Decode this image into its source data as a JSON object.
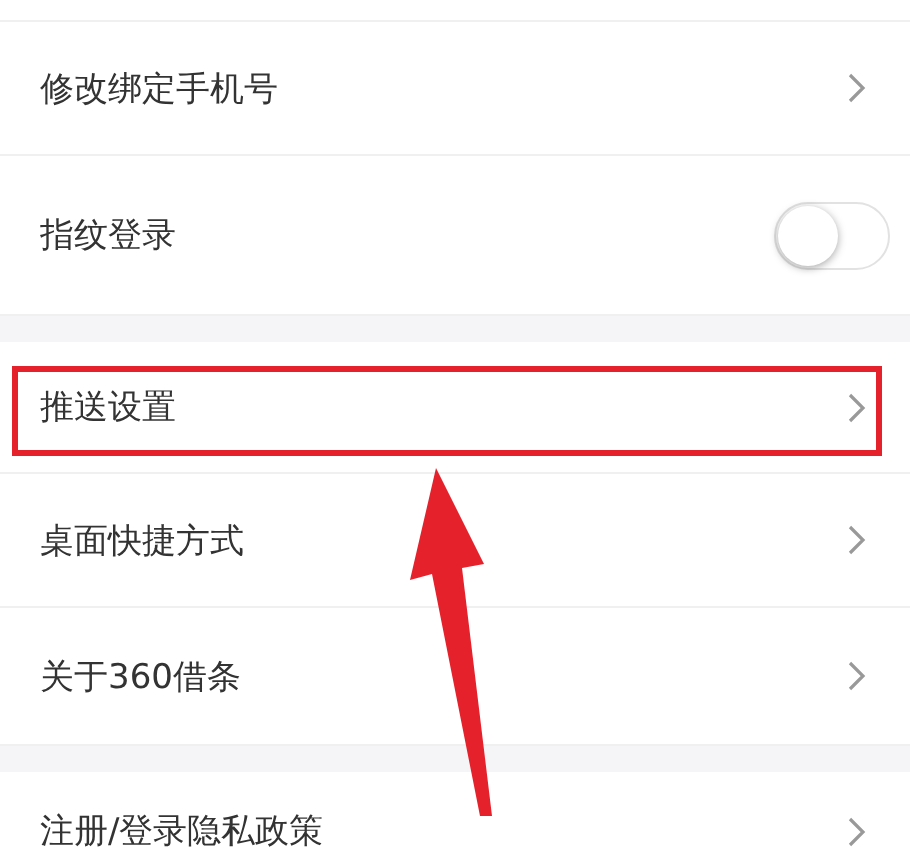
{
  "groups": [
    {
      "items": [
        {
          "kind": "link",
          "label": "修改绑定手机号",
          "highlighted": false
        },
        {
          "kind": "toggle",
          "label": "指纹登录",
          "on": false,
          "highlighted": false
        }
      ]
    },
    {
      "items": [
        {
          "kind": "link",
          "label": "推送设置",
          "highlighted": true
        },
        {
          "kind": "link",
          "label": "桌面快捷方式",
          "highlighted": false
        },
        {
          "kind": "link",
          "label": "关于360借条",
          "highlighted": false
        }
      ]
    },
    {
      "items": [
        {
          "kind": "link",
          "label": "注册/登录隐私政策",
          "highlighted": false
        }
      ]
    }
  ],
  "annotation": {
    "kind": "arrow"
  }
}
